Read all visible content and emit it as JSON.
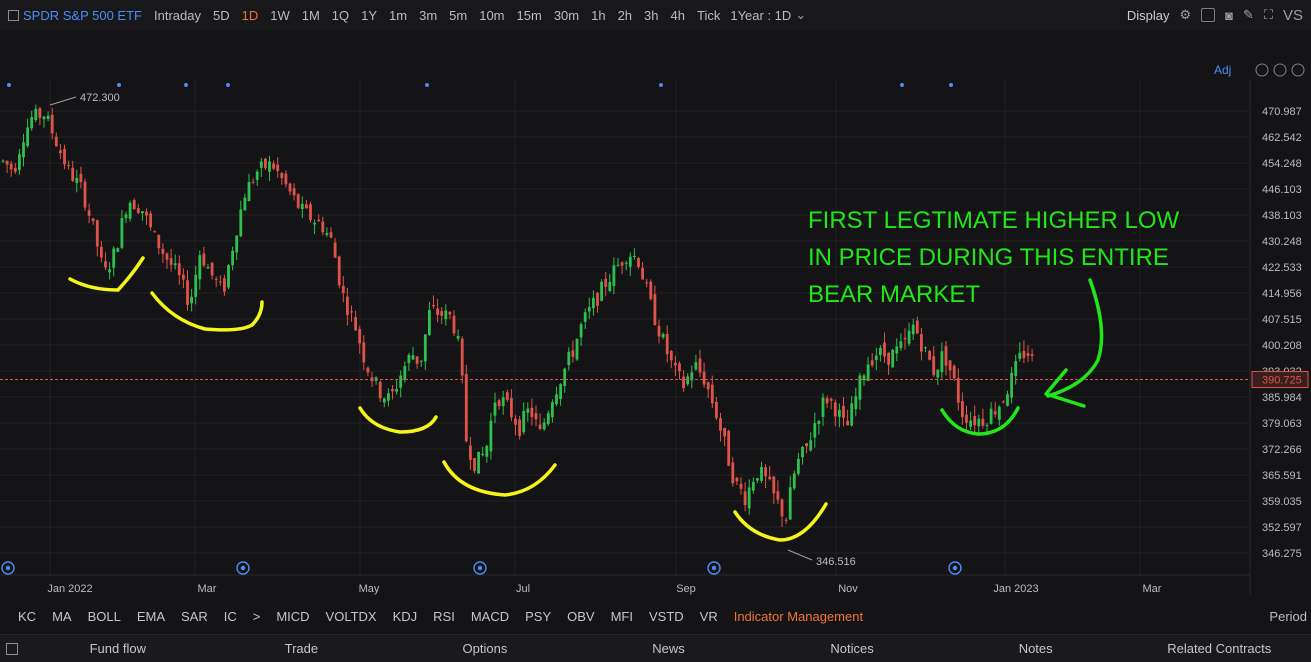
{
  "toolbar": {
    "ticker": "SPDR S&P 500 ETF",
    "timeframes": [
      "Intraday",
      "5D",
      "1D",
      "1W",
      "1M",
      "1Q",
      "1Y",
      "1m",
      "3m",
      "5m",
      "10m",
      "15m",
      "30m",
      "1h",
      "2h",
      "3h",
      "4h",
      "Tick"
    ],
    "active_timeframe": "1D",
    "range_select": "1Year : 1D",
    "display_label": "Display",
    "vs_label": "VS",
    "adj_label": "Adj"
  },
  "chart_data": {
    "type": "candlestick",
    "price_ticks": [
      "470.987",
      "462.542",
      "454.248",
      "446.103",
      "438.103",
      "430.248",
      "422.533",
      "414.956",
      "407.515",
      "400.208",
      "393.032",
      "385.984",
      "379.063",
      "372.266",
      "365.591",
      "359.035",
      "352.597",
      "346.275"
    ],
    "x_labels": [
      "Jan 2022",
      "Mar",
      "May",
      "Jul",
      "Sep",
      "Nov",
      "Jan 2023",
      "Mar"
    ],
    "high_label": "472.300",
    "low_label": "346.516",
    "last_price": "390.725",
    "last_price_color": "#e0534a",
    "up_color": "#2fbf4f",
    "down_color": "#e0534a",
    "annotation_text": [
      "FIRST LEGTIMATE HIGHER LOW",
      "IN PRICE DURING THIS ENTIRE",
      "BEAR MARKET"
    ],
    "annotation_color": "#22e61a",
    "highlight_yellow": "#f5f51a"
  },
  "indicators": [
    "KC",
    "MA",
    "BOLL",
    "EMA",
    "SAR",
    "IC",
    ">",
    "MICD",
    "VOLTDX",
    "KDJ",
    "RSI",
    "MACD",
    "PSY",
    "OBV",
    "MFI",
    "VSTD",
    "VR"
  ],
  "indicator_management": "Indicator Management",
  "period_label": "Period",
  "bottom_tabs": [
    "Fund flow",
    "Trade",
    "Options",
    "News",
    "Notices",
    "Notes",
    "Related Contracts"
  ]
}
